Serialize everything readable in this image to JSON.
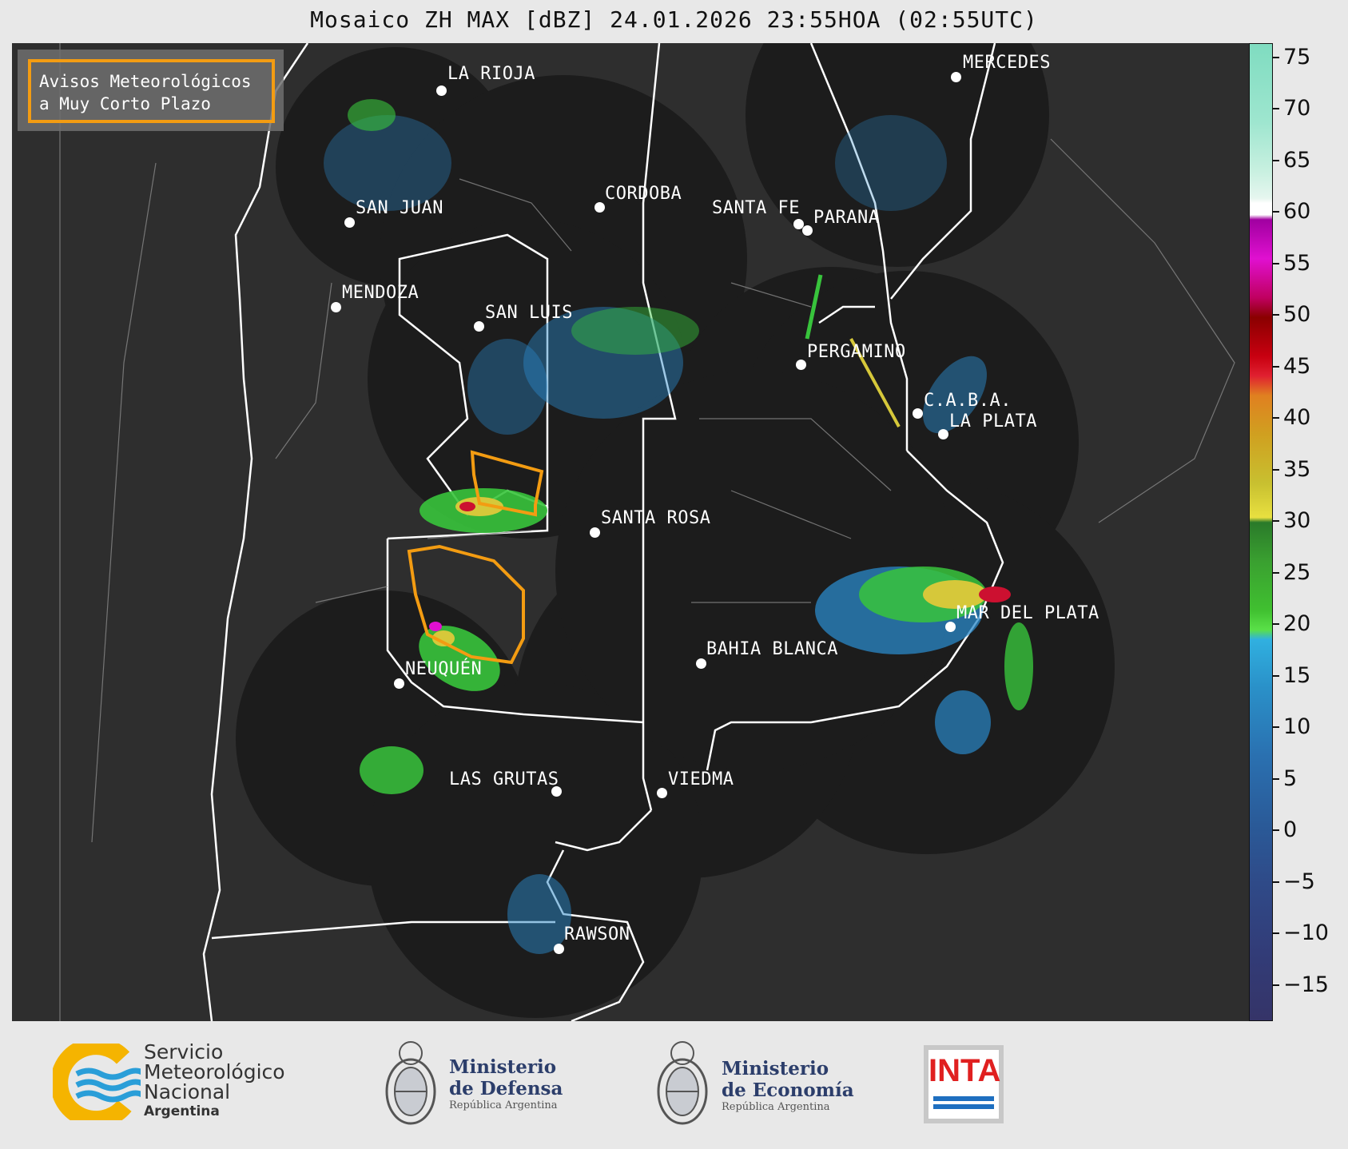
{
  "title": "Mosaico ZH MAX [dBZ] 24.01.2026 23:55HOA (02:55UTC)",
  "warning_legend": {
    "line1": "Avisos Meteorológicos",
    "line2": "a Muy Corto Plazo",
    "border_color": "#f39c12"
  },
  "cities": [
    {
      "name": "LA RIOJA"
    },
    {
      "name": "SAN JUAN"
    },
    {
      "name": "CORDOBA"
    },
    {
      "name": "SANTA FE"
    },
    {
      "name": "PARANA"
    },
    {
      "name": "MERCEDES"
    },
    {
      "name": "MENDOZA"
    },
    {
      "name": "SAN LUIS"
    },
    {
      "name": "PERGAMINO"
    },
    {
      "name": "C.A.B.A."
    },
    {
      "name": "LA PLATA"
    },
    {
      "name": "SANTA ROSA"
    },
    {
      "name": "MAR DEL PLATA"
    },
    {
      "name": "BAHIA BLANCA"
    },
    {
      "name": "NEUQUÉN"
    },
    {
      "name": "LAS GRUTAS"
    },
    {
      "name": "VIEDMA"
    },
    {
      "name": "RAWSON"
    }
  ],
  "colorbar": {
    "unit": "dBZ",
    "ticks": [
      "75",
      "70",
      "65",
      "60",
      "55",
      "50",
      "45",
      "40",
      "35",
      "30",
      "25",
      "20",
      "15",
      "10",
      "5",
      "0",
      "−5",
      "−10",
      "−15"
    ],
    "min": -18,
    "max": 77
  },
  "colors": {
    "map_background": "#2e2e2e",
    "radar_coverage": "#1c1c1c",
    "borders": "#ffffff",
    "warning": "#f39c12"
  },
  "footer": {
    "smn": {
      "line1": "Servicio",
      "line2": "Meteorológico",
      "line3": "Nacional",
      "line4": "Argentina"
    },
    "defensa": {
      "line1": "Ministerio",
      "line2": "de Defensa",
      "line3": "República Argentina"
    },
    "economia": {
      "line1": "Ministerio",
      "line2": "de Economía",
      "line3": "República Argentina"
    },
    "inta": {
      "label": "INTA"
    }
  }
}
